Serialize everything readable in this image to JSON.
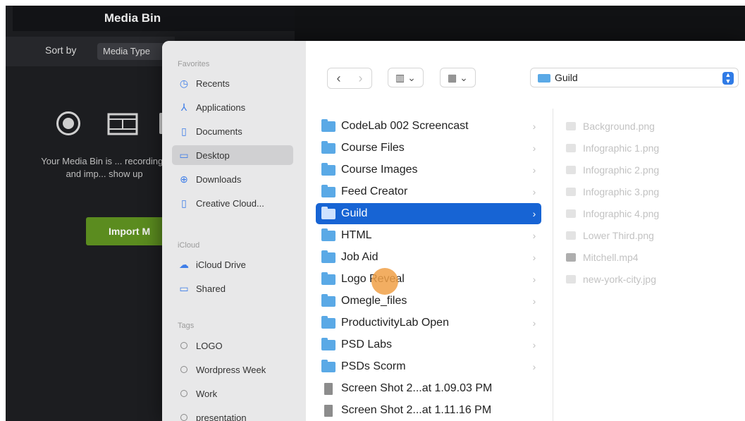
{
  "app": {
    "title": "Media Bin",
    "sort_label": "Sort by",
    "sort_value": "Media Type",
    "empty_text": "Your Media Bin is ... recordings and imp... show up",
    "import_label": "Import M"
  },
  "dialog": {
    "sidebar": {
      "favorites_header": "Favorites",
      "favorites": [
        {
          "label": "Recents",
          "icon": "clock-icon"
        },
        {
          "label": "Applications",
          "icon": "applications-icon"
        },
        {
          "label": "Documents",
          "icon": "document-icon"
        },
        {
          "label": "Desktop",
          "icon": "desktop-icon",
          "selected": true
        },
        {
          "label": "Downloads",
          "icon": "download-icon"
        },
        {
          "label": "Creative Cloud...",
          "icon": "file-icon"
        }
      ],
      "icloud_header": "iCloud",
      "icloud": [
        {
          "label": "iCloud Drive",
          "icon": "cloud-icon"
        },
        {
          "label": "Shared",
          "icon": "shared-folder-icon"
        }
      ],
      "tags_header": "Tags",
      "tags": [
        "LOGO",
        "Wordpress Week",
        "Work",
        "presentation"
      ]
    },
    "toolbar": {
      "back": "‹",
      "forward": "›",
      "column_view": "▥ ⌄",
      "grid_view": "▦ ⌄",
      "location": "Guild"
    },
    "column1": [
      {
        "label": "CodeLab 002 Screencast",
        "type": "folder"
      },
      {
        "label": "Course Files",
        "type": "folder"
      },
      {
        "label": "Course Images",
        "type": "folder"
      },
      {
        "label": "Feed Creator",
        "type": "folder"
      },
      {
        "label": "Guild",
        "type": "folder",
        "selected": true
      },
      {
        "label": "HTML",
        "type": "folder"
      },
      {
        "label": "Job Aid",
        "type": "folder"
      },
      {
        "label": "Logo Reveal",
        "type": "folder"
      },
      {
        "label": "Omegle_files",
        "type": "folder"
      },
      {
        "label": "ProductivityLab Open",
        "type": "folder"
      },
      {
        "label": "PSD Labs",
        "type": "folder"
      },
      {
        "label": "PSDs Scorm",
        "type": "folder"
      },
      {
        "label": "Screen Shot 2...at 1.09.03 PM",
        "type": "file"
      },
      {
        "label": "Screen Shot 2...at 1.11.16 PM",
        "type": "file"
      }
    ],
    "column2": [
      {
        "label": "Background.png",
        "type": "image"
      },
      {
        "label": "Infographic 1.png",
        "type": "image"
      },
      {
        "label": "Infographic 2.png",
        "type": "image"
      },
      {
        "label": "Infographic 3.png",
        "type": "image"
      },
      {
        "label": "Infographic 4.png",
        "type": "image"
      },
      {
        "label": "Lower Third.png",
        "type": "image"
      },
      {
        "label": "Mitchell.mp4",
        "type": "video"
      },
      {
        "label": "new-york-city.jpg",
        "type": "image"
      }
    ]
  }
}
